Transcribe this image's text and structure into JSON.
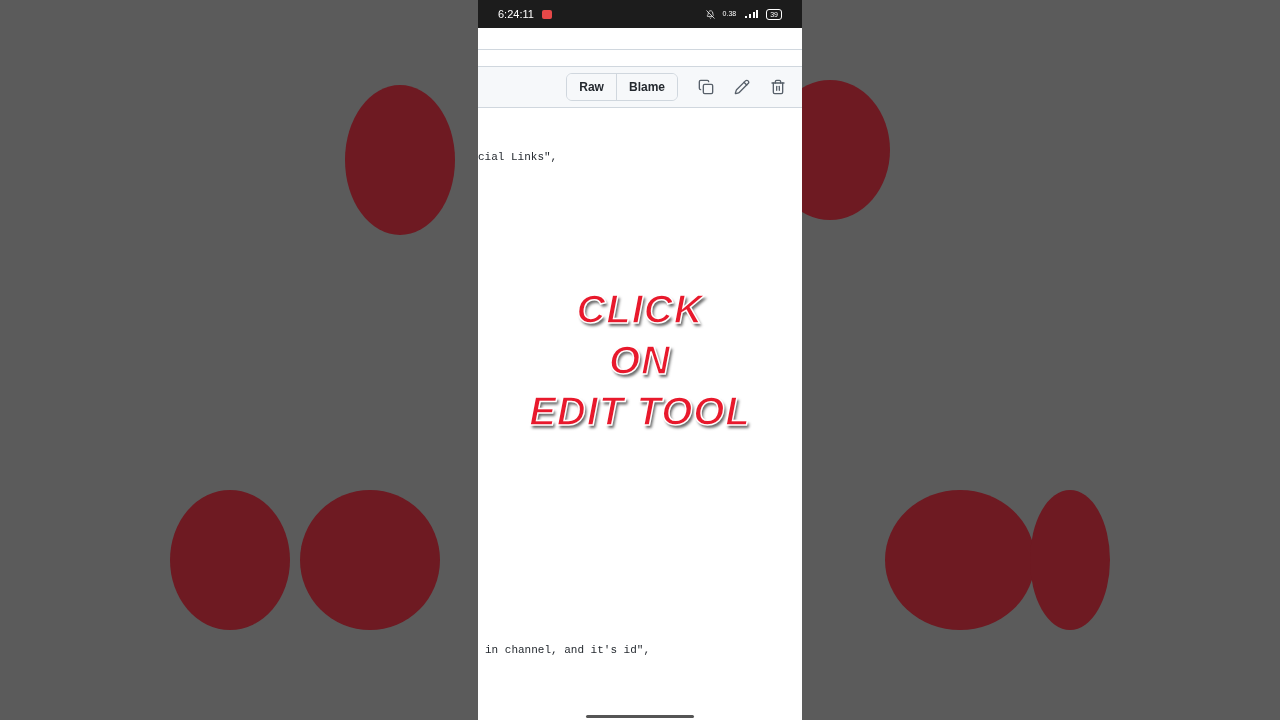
{
  "status_bar": {
    "time": "6:24:11",
    "net_speed": "0.38",
    "battery": "39"
  },
  "toolbar": {
    "buttons": [
      "Raw",
      "Blame"
    ]
  },
  "code_lines": [
    "cial Links\",",
    "in channel, and it's id\","
  ],
  "overlay": [
    "CLICK",
    "ON",
    "EDIT TOOL"
  ]
}
